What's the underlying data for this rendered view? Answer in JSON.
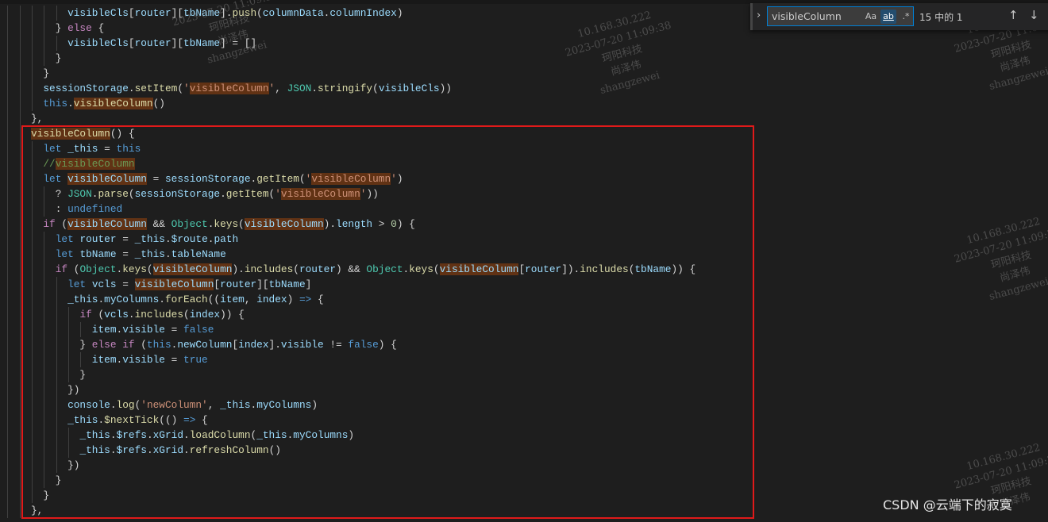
{
  "editor": {
    "lines": [
      [
        [
          "p",
          "      "
        ],
        [
          "v",
          "visibleCls"
        ],
        [
          "p",
          "["
        ],
        [
          "v",
          "router"
        ],
        [
          "p",
          "]["
        ],
        [
          "v",
          "tbName"
        ],
        [
          "p",
          "]."
        ],
        [
          "f",
          "push"
        ],
        [
          "p",
          "("
        ],
        [
          "v",
          "columnData"
        ],
        [
          "p",
          "."
        ],
        [
          "v",
          "columnIndex"
        ],
        [
          "p",
          ")"
        ]
      ],
      [
        [
          "p",
          "    } "
        ],
        [
          "c",
          "else"
        ],
        [
          "p",
          " {"
        ]
      ],
      [
        [
          "p",
          "      "
        ],
        [
          "v",
          "visibleCls"
        ],
        [
          "p",
          "["
        ],
        [
          "v",
          "router"
        ],
        [
          "p",
          "]["
        ],
        [
          "v",
          "tbName"
        ],
        [
          "p",
          "] = []"
        ]
      ],
      [
        [
          "p",
          "    }"
        ]
      ],
      [
        [
          "p",
          "  }"
        ]
      ],
      [
        [
          "p",
          "  "
        ],
        [
          "v",
          "sessionStorage"
        ],
        [
          "p",
          "."
        ],
        [
          "f",
          "setItem"
        ],
        [
          "p",
          "("
        ],
        [
          "s",
          "'"
        ],
        [
          "s hl",
          "visibleColumn"
        ],
        [
          "s",
          "'"
        ],
        [
          "p",
          ", "
        ],
        [
          "t",
          "JSON"
        ],
        [
          "p",
          "."
        ],
        [
          "f",
          "stringify"
        ],
        [
          "p",
          "("
        ],
        [
          "v",
          "visibleCls"
        ],
        [
          "p",
          "))"
        ]
      ],
      [
        [
          "p",
          "  "
        ],
        [
          "k",
          "this"
        ],
        [
          "p",
          "."
        ],
        [
          "f hl",
          "visibleColumn"
        ],
        [
          "p",
          "()"
        ]
      ],
      [
        [
          "p",
          "},"
        ]
      ],
      [
        [
          "f hl",
          "visibleColumn"
        ],
        [
          "p",
          "() {"
        ]
      ],
      [
        [
          "p",
          "  "
        ],
        [
          "k",
          "let"
        ],
        [
          "p",
          " "
        ],
        [
          "v",
          "_this"
        ],
        [
          "p",
          " = "
        ],
        [
          "k",
          "this"
        ]
      ],
      [
        [
          "p",
          "  "
        ],
        [
          "m",
          "//"
        ],
        [
          "m hl",
          "visibleColumn"
        ]
      ],
      [
        [
          "p",
          "  "
        ],
        [
          "k",
          "let"
        ],
        [
          "p",
          " "
        ],
        [
          "v hl",
          "visibleColumn"
        ],
        [
          "p",
          " = "
        ],
        [
          "v",
          "sessionStorage"
        ],
        [
          "p",
          "."
        ],
        [
          "f",
          "getItem"
        ],
        [
          "p",
          "("
        ],
        [
          "s",
          "'"
        ],
        [
          "s hl",
          "visibleColumn"
        ],
        [
          "s",
          "'"
        ],
        [
          "p",
          ")"
        ]
      ],
      [
        [
          "p",
          "    ? "
        ],
        [
          "t",
          "JSON"
        ],
        [
          "p",
          "."
        ],
        [
          "f",
          "parse"
        ],
        [
          "p",
          "("
        ],
        [
          "v",
          "sessionStorage"
        ],
        [
          "p",
          "."
        ],
        [
          "f",
          "getItem"
        ],
        [
          "p",
          "("
        ],
        [
          "s",
          "'"
        ],
        [
          "s hl",
          "visibleColumn"
        ],
        [
          "s",
          "'"
        ],
        [
          "p",
          "))"
        ]
      ],
      [
        [
          "p",
          "    : "
        ],
        [
          "k",
          "undefined"
        ]
      ],
      [
        [
          "p",
          "  "
        ],
        [
          "c",
          "if"
        ],
        [
          "p",
          " ("
        ],
        [
          "v hl",
          "visibleColumn"
        ],
        [
          "p",
          " && "
        ],
        [
          "t",
          "Object"
        ],
        [
          "p",
          "."
        ],
        [
          "f",
          "keys"
        ],
        [
          "p",
          "("
        ],
        [
          "v hl",
          "visibleColumn"
        ],
        [
          "p",
          ")."
        ],
        [
          "v",
          "length"
        ],
        [
          "p",
          " > "
        ],
        [
          "n",
          "0"
        ],
        [
          "p",
          ") {"
        ]
      ],
      [
        [
          "p",
          "    "
        ],
        [
          "k",
          "let"
        ],
        [
          "p",
          " "
        ],
        [
          "v",
          "router"
        ],
        [
          "p",
          " = "
        ],
        [
          "v",
          "_this"
        ],
        [
          "p",
          "."
        ],
        [
          "v",
          "$route"
        ],
        [
          "p",
          "."
        ],
        [
          "v",
          "path"
        ]
      ],
      [
        [
          "p",
          "    "
        ],
        [
          "k",
          "let"
        ],
        [
          "p",
          " "
        ],
        [
          "v",
          "tbName"
        ],
        [
          "p",
          " = "
        ],
        [
          "v",
          "_this"
        ],
        [
          "p",
          "."
        ],
        [
          "v",
          "tableName"
        ]
      ],
      [
        [
          "p",
          "    "
        ],
        [
          "c",
          "if"
        ],
        [
          "p",
          " ("
        ],
        [
          "t",
          "Object"
        ],
        [
          "p",
          "."
        ],
        [
          "f",
          "keys"
        ],
        [
          "p",
          "("
        ],
        [
          "v hl",
          "visibleColumn"
        ],
        [
          "p",
          ")."
        ],
        [
          "f",
          "includes"
        ],
        [
          "p",
          "("
        ],
        [
          "v",
          "router"
        ],
        [
          "p",
          ") && "
        ],
        [
          "t",
          "Object"
        ],
        [
          "p",
          "."
        ],
        [
          "f",
          "keys"
        ],
        [
          "p",
          "("
        ],
        [
          "v hl",
          "visibleColumn"
        ],
        [
          "p",
          "["
        ],
        [
          "v",
          "router"
        ],
        [
          "p",
          "])."
        ],
        [
          "f",
          "includes"
        ],
        [
          "p",
          "("
        ],
        [
          "v",
          "tbName"
        ],
        [
          "p",
          ")) {"
        ]
      ],
      [
        [
          "p",
          "      "
        ],
        [
          "k",
          "let"
        ],
        [
          "p",
          " "
        ],
        [
          "v",
          "vcls"
        ],
        [
          "p",
          " = "
        ],
        [
          "v hl",
          "visibleColumn"
        ],
        [
          "p",
          "["
        ],
        [
          "v",
          "router"
        ],
        [
          "p",
          "]["
        ],
        [
          "v",
          "tbName"
        ],
        [
          "p",
          "]"
        ]
      ],
      [
        [
          "p",
          "      "
        ],
        [
          "v",
          "_this"
        ],
        [
          "p",
          "."
        ],
        [
          "v",
          "myColumns"
        ],
        [
          "p",
          "."
        ],
        [
          "f",
          "forEach"
        ],
        [
          "p",
          "(("
        ],
        [
          "v",
          "item"
        ],
        [
          "p",
          ", "
        ],
        [
          "v",
          "index"
        ],
        [
          "p",
          ") "
        ],
        [
          "k",
          "=>"
        ],
        [
          "p",
          " {"
        ]
      ],
      [
        [
          "p",
          "        "
        ],
        [
          "c",
          "if"
        ],
        [
          "p",
          " ("
        ],
        [
          "v",
          "vcls"
        ],
        [
          "p",
          "."
        ],
        [
          "f",
          "includes"
        ],
        [
          "p",
          "("
        ],
        [
          "v",
          "index"
        ],
        [
          "p",
          ")) {"
        ]
      ],
      [
        [
          "p",
          "          "
        ],
        [
          "v",
          "item"
        ],
        [
          "p",
          "."
        ],
        [
          "v",
          "visible"
        ],
        [
          "p",
          " = "
        ],
        [
          "k",
          "false"
        ]
      ],
      [
        [
          "p",
          "        } "
        ],
        [
          "c",
          "else if"
        ],
        [
          "p",
          " ("
        ],
        [
          "k",
          "this"
        ],
        [
          "p",
          "."
        ],
        [
          "v",
          "newColumn"
        ],
        [
          "p",
          "["
        ],
        [
          "v",
          "index"
        ],
        [
          "p",
          "]."
        ],
        [
          "v",
          "visible"
        ],
        [
          "p",
          " != "
        ],
        [
          "k",
          "false"
        ],
        [
          "p",
          ") {"
        ]
      ],
      [
        [
          "p",
          "          "
        ],
        [
          "v",
          "item"
        ],
        [
          "p",
          "."
        ],
        [
          "v",
          "visible"
        ],
        [
          "p",
          " = "
        ],
        [
          "k",
          "true"
        ]
      ],
      [
        [
          "p",
          "        }"
        ]
      ],
      [
        [
          "p",
          "      })"
        ]
      ],
      [
        [
          "p",
          "      "
        ],
        [
          "v",
          "console"
        ],
        [
          "p",
          "."
        ],
        [
          "f",
          "log"
        ],
        [
          "p",
          "("
        ],
        [
          "s",
          "'newColumn'"
        ],
        [
          "p",
          ", "
        ],
        [
          "v",
          "_this"
        ],
        [
          "p",
          "."
        ],
        [
          "v",
          "myColumns"
        ],
        [
          "p",
          ")"
        ]
      ],
      [
        [
          "p",
          "      "
        ],
        [
          "v",
          "_this"
        ],
        [
          "p",
          "."
        ],
        [
          "f",
          "$nextTick"
        ],
        [
          "p",
          "(() "
        ],
        [
          "k",
          "=>"
        ],
        [
          "p",
          " {"
        ]
      ],
      [
        [
          "p",
          "        "
        ],
        [
          "v",
          "_this"
        ],
        [
          "p",
          "."
        ],
        [
          "v",
          "$refs"
        ],
        [
          "p",
          "."
        ],
        [
          "v",
          "xGrid"
        ],
        [
          "p",
          "."
        ],
        [
          "f",
          "loadColumn"
        ],
        [
          "p",
          "("
        ],
        [
          "v",
          "_this"
        ],
        [
          "p",
          "."
        ],
        [
          "v",
          "myColumns"
        ],
        [
          "p",
          ")"
        ]
      ],
      [
        [
          "p",
          "        "
        ],
        [
          "v",
          "_this"
        ],
        [
          "p",
          "."
        ],
        [
          "v",
          "$refs"
        ],
        [
          "p",
          "."
        ],
        [
          "v",
          "xGrid"
        ],
        [
          "p",
          "."
        ],
        [
          "f",
          "refreshColumn"
        ],
        [
          "p",
          "()"
        ]
      ],
      [
        [
          "p",
          "      })"
        ]
      ],
      [
        [
          "p",
          "    }"
        ]
      ],
      [
        [
          "p",
          "  }"
        ]
      ],
      [
        [
          "p",
          "},"
        ]
      ]
    ],
    "highlight_color": "#613214",
    "annotation_box_color": "#e01a1a"
  },
  "find_widget": {
    "query": "visibleColumn",
    "match_case_label": "Aa",
    "whole_word_label": "ab",
    "regex_label": ".*",
    "match_count": "15 中的 1",
    "prev_icon": "arrow-up-icon",
    "next_icon": "arrow-down-icon",
    "prev_label": "↑",
    "next_label": "↓",
    "toggle_label": "›"
  },
  "watermark": {
    "ip": "10.168.30.222",
    "datetime": "2023-07-20 11:09:38",
    "company": "珂阳科技",
    "name_cn": "尚泽伟",
    "name_en": "shangzewei"
  },
  "csdn_watermark": "CSDN @云端下的寂寞"
}
